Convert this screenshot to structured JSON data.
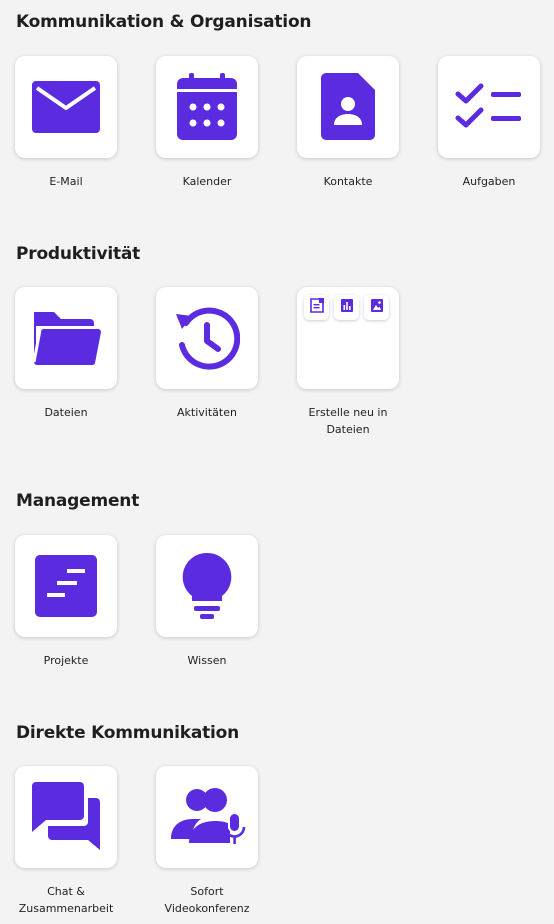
{
  "colors": {
    "accent": "#5b2be0",
    "background": "#f3f3f3",
    "tile": "#ffffff"
  },
  "sections": [
    {
      "title": "Kommunikation & Organisation",
      "apps": [
        {
          "label": "E-Mail",
          "icon": "mail-icon"
        },
        {
          "label": "Kalender",
          "icon": "calendar-icon"
        },
        {
          "label": "Kontakte",
          "icon": "contacts-icon"
        },
        {
          "label": "Aufgaben",
          "icon": "tasks-icon"
        }
      ]
    },
    {
      "title": "Produktivität",
      "apps": [
        {
          "label": "Dateien",
          "icon": "folder-icon"
        },
        {
          "label": "Aktivitäten",
          "icon": "history-icon"
        },
        {
          "label": "Erstelle neu in Dateien",
          "icon": "create-new-icon",
          "actions": [
            {
              "icon": "new-document-icon"
            },
            {
              "icon": "new-spreadsheet-icon"
            },
            {
              "icon": "new-image-icon"
            }
          ]
        }
      ]
    },
    {
      "title": "Management",
      "apps": [
        {
          "label": "Projekte",
          "icon": "projects-icon"
        },
        {
          "label": "Wissen",
          "icon": "lightbulb-icon"
        }
      ]
    },
    {
      "title": "Direkte Kommunikation",
      "apps": [
        {
          "label": "Chat & Zusammenarbeit",
          "icon": "chat-icon"
        },
        {
          "label": "Sofort Videokonferenz",
          "icon": "video-conference-icon"
        }
      ]
    }
  ]
}
